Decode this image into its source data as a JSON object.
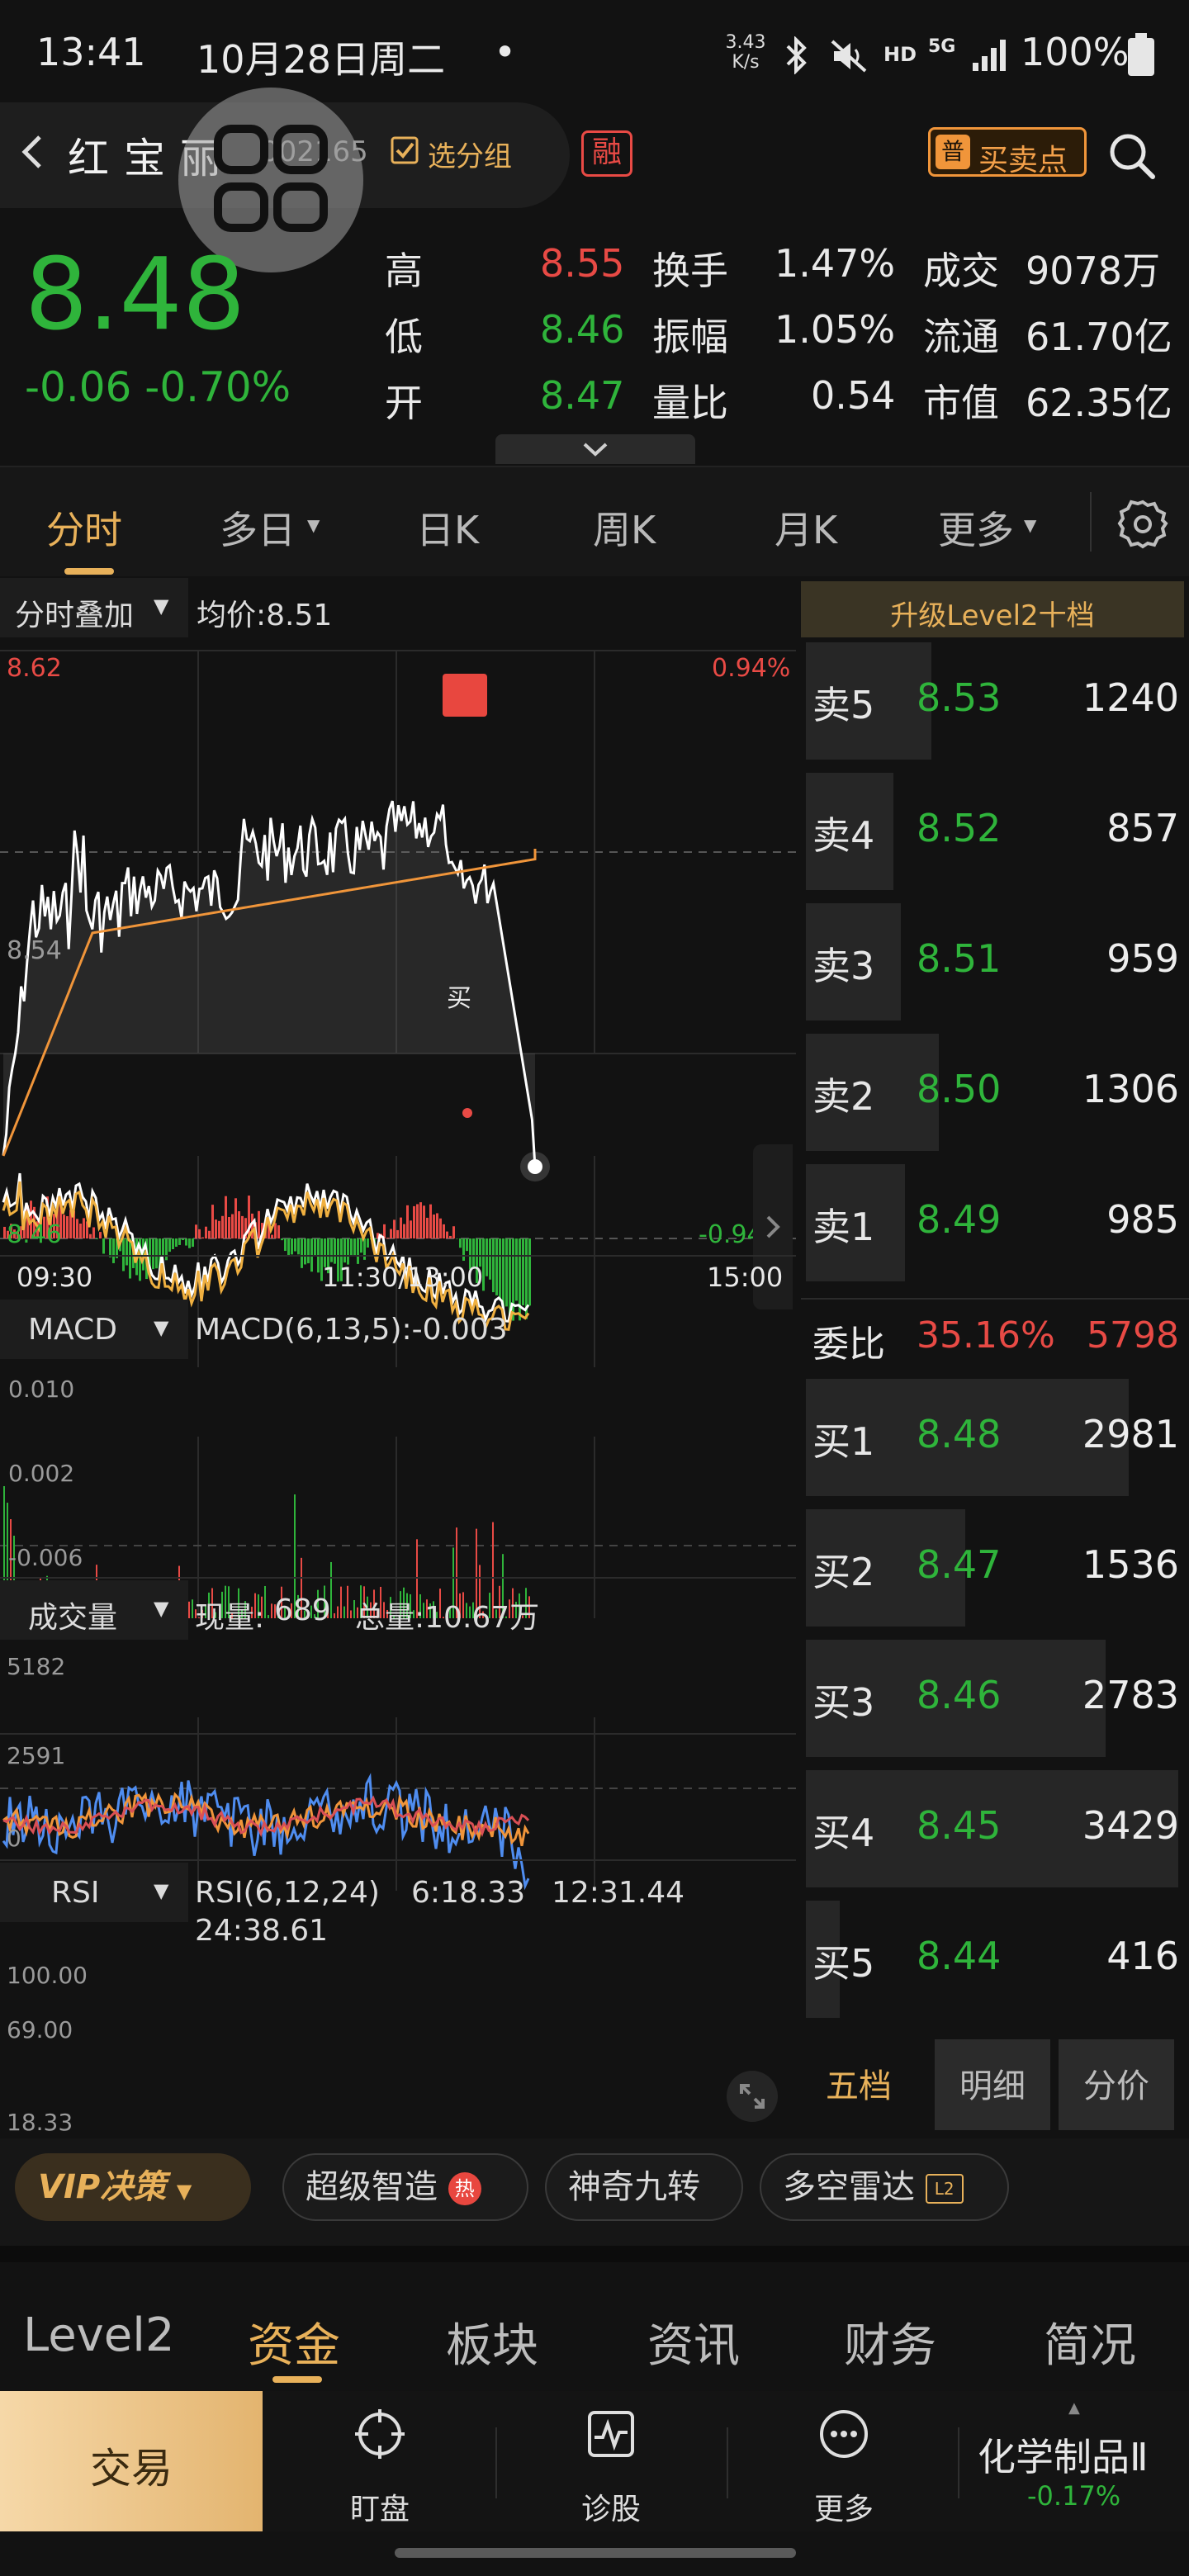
{
  "status_bar": {
    "time": "13:41",
    "date": "10月28日周二",
    "dot": "•",
    "net_speed_1": "3.43",
    "net_speed_2": "K/s",
    "hd": "HD",
    "sig": "5G",
    "battery": "100%"
  },
  "header": {
    "name": "红宝丽",
    "code": "002165",
    "group_label": "选分组",
    "rong_badge": "融",
    "buy_point_icon": "普",
    "buy_point_label": "买卖点"
  },
  "quote": {
    "price": "8.48",
    "change": "-0.06",
    "change_pct": "-0.70%",
    "high_label": "高",
    "high": "8.55",
    "low_label": "低",
    "low": "8.46",
    "open_label": "开",
    "open": "8.47",
    "turnover_label": "换手",
    "turnover": "1.47%",
    "amplitude_label": "振幅",
    "amplitude": "1.05%",
    "vol_ratio_label": "量比",
    "vol_ratio": "0.54",
    "amount_label": "成交",
    "amount": "9078万",
    "float_cap_label": "流通",
    "float_cap": "61.70亿",
    "mkt_cap_label": "市值",
    "mkt_cap": "62.35亿"
  },
  "tabs": [
    "分时",
    "多日",
    "日K",
    "周K",
    "月K",
    "更多"
  ],
  "intraday": {
    "overlay_label": "分时叠加",
    "avg_label": "均价:8.51",
    "y_top": "8.62",
    "y_mid": "8.54",
    "y_bot": "8.46",
    "pct_top": "0.94%",
    "pct_bot": "-0.94%",
    "buy_marker": "买",
    "t_start": "09:30",
    "t_mid": "11:30/13:00",
    "t_end": "15:00"
  },
  "macd": {
    "label": "MACD",
    "value": "MACD(6,13,5):-0.003",
    "y_top": "0.010",
    "y_mid": "0.002",
    "y_bot": "-0.006"
  },
  "volume": {
    "label": "成交量",
    "now_label": "现量:",
    "now": "689",
    "total": "总量:10.67万",
    "y_top": "5182",
    "y_mid": "2591",
    "y_bot": "0"
  },
  "rsi": {
    "label": "RSI",
    "params": "RSI(6,12,24)",
    "r6": "6:18.33",
    "r12": "12:31.44",
    "r24": "24:38.61",
    "y_top": "100.00",
    "y_mid": "69.00",
    "y_bot": "18.33"
  },
  "orderbook": {
    "upgrade": "升级Level2十档",
    "sells": [
      {
        "label": "卖5",
        "price": "8.53",
        "vol": "1240",
        "w": 0.33
      },
      {
        "label": "卖4",
        "price": "8.52",
        "vol": "857",
        "w": 0.23
      },
      {
        "label": "卖3",
        "price": "8.51",
        "vol": "959",
        "w": 0.25
      },
      {
        "label": "卖2",
        "price": "8.50",
        "vol": "1306",
        "w": 0.35
      },
      {
        "label": "卖1",
        "price": "8.49",
        "vol": "985",
        "w": 0.26
      }
    ],
    "ratio_label": "委比",
    "ratio_pct": "35.16%",
    "ratio_val": "5798",
    "buys": [
      {
        "label": "买1",
        "price": "8.48",
        "vol": "2981",
        "w": 0.85
      },
      {
        "label": "买2",
        "price": "8.47",
        "vol": "1536",
        "w": 0.42
      },
      {
        "label": "买3",
        "price": "8.46",
        "vol": "2783",
        "w": 0.79
      },
      {
        "label": "买4",
        "price": "8.45",
        "vol": "3429",
        "w": 0.98
      },
      {
        "label": "买5",
        "price": "8.44",
        "vol": "416",
        "w": 0.09
      }
    ],
    "tab_five": "五档",
    "tab_detail": "明细",
    "tab_price": "分价"
  },
  "features": {
    "vip": "VIP决策",
    "chip1": "超级智造",
    "chip1_badge": "热",
    "chip2": "神奇九转",
    "chip3": "多空雷达",
    "chip3_badge": "L2"
  },
  "info_tabs": [
    "Level2",
    "资金",
    "板块",
    "资讯",
    "财务",
    "简况"
  ],
  "bottom_nav": {
    "trade": "交易",
    "watch": "盯盘",
    "diagnose": "诊股",
    "more": "更多",
    "sector_name": "化学制品Ⅱ",
    "sector_change": "-0.17%"
  },
  "colors": {
    "up": "#e84a45",
    "down": "#2fb43b",
    "accent": "#e8b15a",
    "avg_line": "#f0953a"
  }
}
